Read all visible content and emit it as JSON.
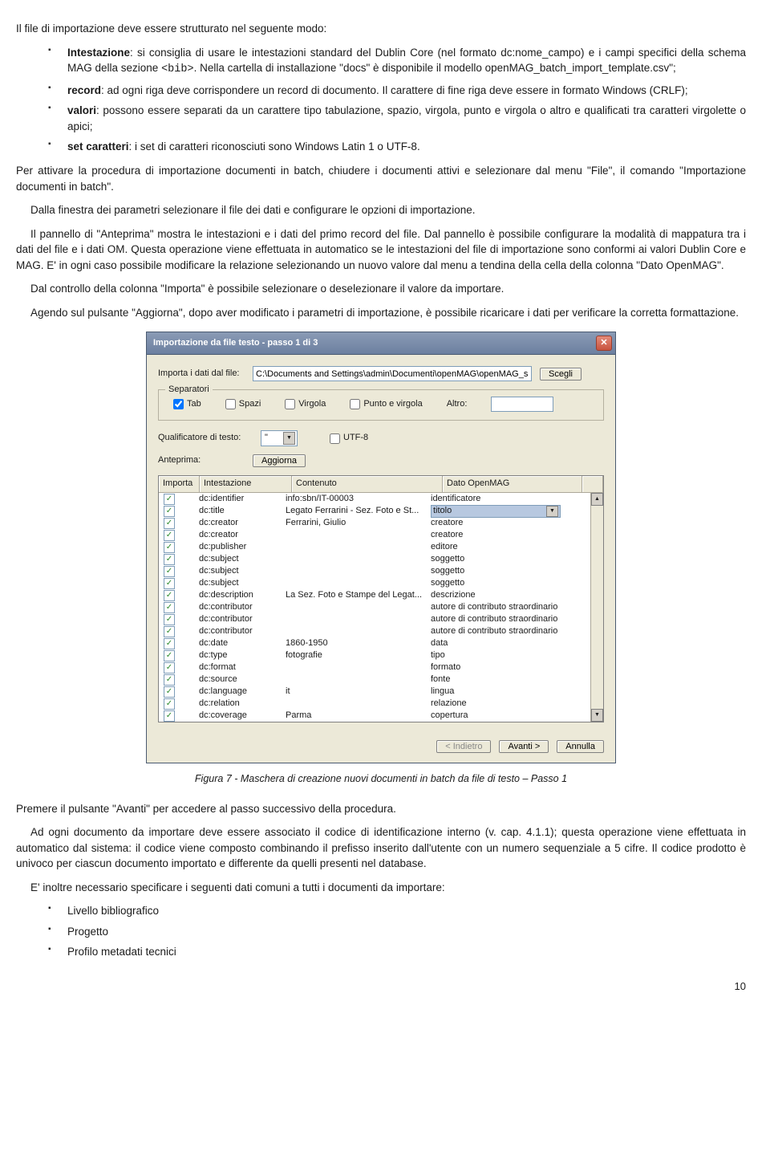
{
  "intro": "Il file di importazione deve essere strutturato nel seguente modo:",
  "bullets1": [
    {
      "b": "Intestazione",
      "rest": ": si consiglia di usare le intestazioni standard del Dublin Core (nel formato dc:nome_campo) e i campi specifici della schema MAG della sezione ",
      "code": "<bib>",
      "rest2": ". Nella cartella di installazione \"docs\" è disponibile il modello openMAG_batch_import_template.csv\";"
    },
    {
      "b": "record",
      "rest": ": ad ogni riga deve corrispondere un record di documento. Il carattere di fine riga deve essere in formato Windows (CRLF);",
      "code": "",
      "rest2": ""
    },
    {
      "b": "valori",
      "rest": ": possono essere separati da un carattere tipo tabulazione, spazio, virgola, punto e virgola o altro e qualificati tra caratteri virgolette o apici;",
      "code": "",
      "rest2": ""
    },
    {
      "b": "set caratteri",
      "rest": ": i set di caratteri riconosciuti sono Windows Latin 1 o UTF-8.",
      "code": "",
      "rest2": ""
    }
  ],
  "p1": "Per attivare la procedura di importazione documenti in batch, chiudere i documenti attivi e selezionare dal menu \"File\", il comando \"Importazione documenti in batch\".",
  "p2": "Dalla finestra dei parametri selezionare il file dei dati e configurare le opzioni di importazione.",
  "p3": "Il pannello di \"Anteprima\" mostra le intestazioni e i dati del primo record del file. Dal pannello è possibile configurare la modalità di mappatura tra i dati del file e i dati OM. Questa operazione viene effettuata in automatico se le intestazioni del file di importazione sono conformi ai valori Dublin Core e MAG. E' in ogni caso possibile modificare la relazione selezionando un nuovo valore dal menu a tendina della cella della colonna \"Dato OpenMAG\".",
  "p4": "Dal controllo della colonna \"Importa\" è possibile selezionare o deselezionare il valore da importare.",
  "p5": "Agendo sul pulsante \"Aggiorna\", dopo aver modificato i parametri di importazione, è possibile ricaricare i dati per verificare la corretta formattazione.",
  "dialog": {
    "title": "Importazione da file testo - passo 1 di 3",
    "importLbl": "Importa i dati dal file:",
    "importPath": "C:\\Documents and Settings\\admin\\Documenti\\openMAG\\openMAG_samples\\o",
    "browse": "Scegli",
    "sepLegend": "Separatori",
    "sep": {
      "tab": "Tab",
      "spazi": "Spazi",
      "virgola": "Virgola",
      "pv": "Punto e virgola",
      "altro": "Altro:"
    },
    "qualLbl": "Qualificatore di testo:",
    "qualVal": "\"",
    "utf8": "UTF-8",
    "anteprimaLbl": "Anteprima:",
    "aggiorna": "Aggiorna",
    "headers": {
      "h1": "Importa",
      "h2": "Intestazione",
      "h3": "Contenuto",
      "h4": "Dato OpenMAG"
    },
    "rows": [
      {
        "h": "dc:identifier",
        "c": "info:sbn/IT-00003",
        "d": "identificatore",
        "sel": false
      },
      {
        "h": "dc:title",
        "c": "Legato Ferrarini - Sez. Foto e St...",
        "d": "titolo",
        "sel": true
      },
      {
        "h": "dc:creator",
        "c": "Ferrarini, Giulio",
        "d": "creatore",
        "sel": false
      },
      {
        "h": "dc:creator",
        "c": "",
        "d": "creatore",
        "sel": false
      },
      {
        "h": "dc:publisher",
        "c": "",
        "d": "editore",
        "sel": false
      },
      {
        "h": "dc:subject",
        "c": "",
        "d": "soggetto",
        "sel": false
      },
      {
        "h": "dc:subject",
        "c": "",
        "d": "soggetto",
        "sel": false
      },
      {
        "h": "dc:subject",
        "c": "",
        "d": "soggetto",
        "sel": false
      },
      {
        "h": "dc:description",
        "c": "La Sez. Foto e Stampe del Legat...",
        "d": "descrizione",
        "sel": false
      },
      {
        "h": "dc:contributor",
        "c": "",
        "d": "autore di contributo straordinario",
        "sel": false
      },
      {
        "h": "dc:contributor",
        "c": "",
        "d": "autore di contributo straordinario",
        "sel": false
      },
      {
        "h": "dc:contributor",
        "c": "",
        "d": "autore di contributo straordinario",
        "sel": false
      },
      {
        "h": "dc:date",
        "c": "1860-1950",
        "d": "data",
        "sel": false
      },
      {
        "h": "dc:type",
        "c": "fotografie",
        "d": "tipo",
        "sel": false
      },
      {
        "h": "dc:format",
        "c": "",
        "d": "formato",
        "sel": false
      },
      {
        "h": "dc:source",
        "c": "",
        "d": "fonte",
        "sel": false
      },
      {
        "h": "dc:language",
        "c": "it",
        "d": "lingua",
        "sel": false
      },
      {
        "h": "dc:relation",
        "c": "",
        "d": "relazione",
        "sel": false
      },
      {
        "h": "dc:coverage",
        "c": "Parma",
        "d": "copertura",
        "sel": false
      }
    ],
    "indietro": "< Indietro",
    "avanti": "Avanti >",
    "annulla": "Annulla"
  },
  "figcap": "Figura 7 - Maschera di creazione nuovi documenti in batch da file di testo – Passo 1",
  "p6": "Premere il pulsante \"Avanti\" per accedere al passo successivo della procedura.",
  "p7": "Ad ogni documento da importare deve essere associato il codice di identificazione interno (v. cap. 4.1.1); questa operazione viene effettuata in automatico dal sistema: il codice viene composto combinando il prefisso inserito dall'utente con un numero sequenziale a 5 cifre. Il codice prodotto è univoco per ciascun documento importato e differente da quelli presenti nel database.",
  "p8": "E' inoltre necessario specificare i seguenti dati comuni a tutti i documenti da importare:",
  "bullets2": [
    "Livello bibliografico",
    "Progetto",
    "Profilo metadati tecnici"
  ],
  "pagenum": "10"
}
